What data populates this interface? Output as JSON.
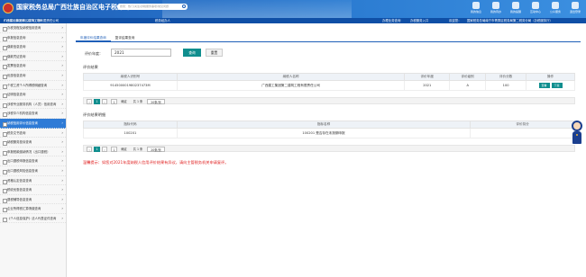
{
  "header": {
    "title": "国家税务总局广西壮族自治区电子税务局",
    "search_placeholder": "搜索：热门/关注/办税服务事项/常见问题",
    "nav": [
      "我的信息",
      "我的待办",
      "我的提醒",
      "互动中心",
      "公众服务",
      "退出登录"
    ]
  },
  "subbar": {
    "tax_id": "914500001980237473M",
    "company_short": "广西建工集团第二建筑工程有限责任公司",
    "role": "税务经办人",
    "today_label": "办理业务查询",
    "entry": "办税服务入口",
    "right_note": "欢迎您：",
    "right_user": "国家税务总局南宁市青秀区税务局第二税务分局（办税服务厅）"
  },
  "sidebar": {
    "items": [
      "办税流程及纳税信用查询",
      "申报信息查询",
      "缴款信息查询",
      "缴款凭证查询",
      "发票信息查询",
      "优惠信息查询",
      "个税工资个人所得税明细查询",
      "证明信息查询",
      "涉税专业服务机构（人员）信用查询",
      "涉税中介机构信息查询",
      "纳税信用评价信息查询",
      "税务文书查询",
      "纳税服务投诉查询",
      "申报税款缴纳情况（出口退税）",
      "出口退税申报信息查询",
      "出口退税风险信息查询",
      "资格认定信息查询",
      "税收优惠信息查询",
      "退税辅导信息查询",
      "企业所得税汇算清缴查询",
      "《个人信息保护》法人代表证件查询"
    ],
    "active_index": 10
  },
  "tabs": [
    "年度评价结果查询",
    "复评结果查询"
  ],
  "query": {
    "year_label": "评价年度：",
    "year_value": "2021",
    "query_button": "查询",
    "reset_button": "重置"
  },
  "result_section": {
    "title": "评价结果",
    "columns": [
      "纳税人识别号",
      "纳税人名称",
      "评价年度",
      "评价级别",
      "评价分数",
      "操作"
    ],
    "row": {
      "tax_id": "914500001980237473M",
      "name": "广西建工集团第二建筑工程有限责任公司",
      "year": "2021",
      "level": "A",
      "score": "100",
      "actions": [
        "查看",
        "下载"
      ]
    },
    "pager": {
      "prev": "‹",
      "page": "1",
      "next": "›",
      "goto_label": "确定",
      "total": "共 1 条",
      "page_size": "20条/页"
    }
  },
  "detail_section": {
    "title": "评价结果明细",
    "columns": [
      "指标代码",
      "指标名称",
      "评价扣分"
    ],
    "row": {
      "code": "100201",
      "name": "100201 是否存在未按期申报",
      "deduct": ""
    },
    "pager": {
      "prev": "‹",
      "page": "1",
      "next": "›",
      "goto_label": "确定",
      "total": "共 1 条",
      "page_size": "20条/页"
    }
  },
  "tip": "温馨提示：如您对2021年度纳税人信用评价结果有异议，请向主管税务机关申请复评。",
  "colors": {
    "header_blue": "#1f5fb8",
    "teal_button": "#0f8e8e",
    "warning_red": "#e02020"
  }
}
